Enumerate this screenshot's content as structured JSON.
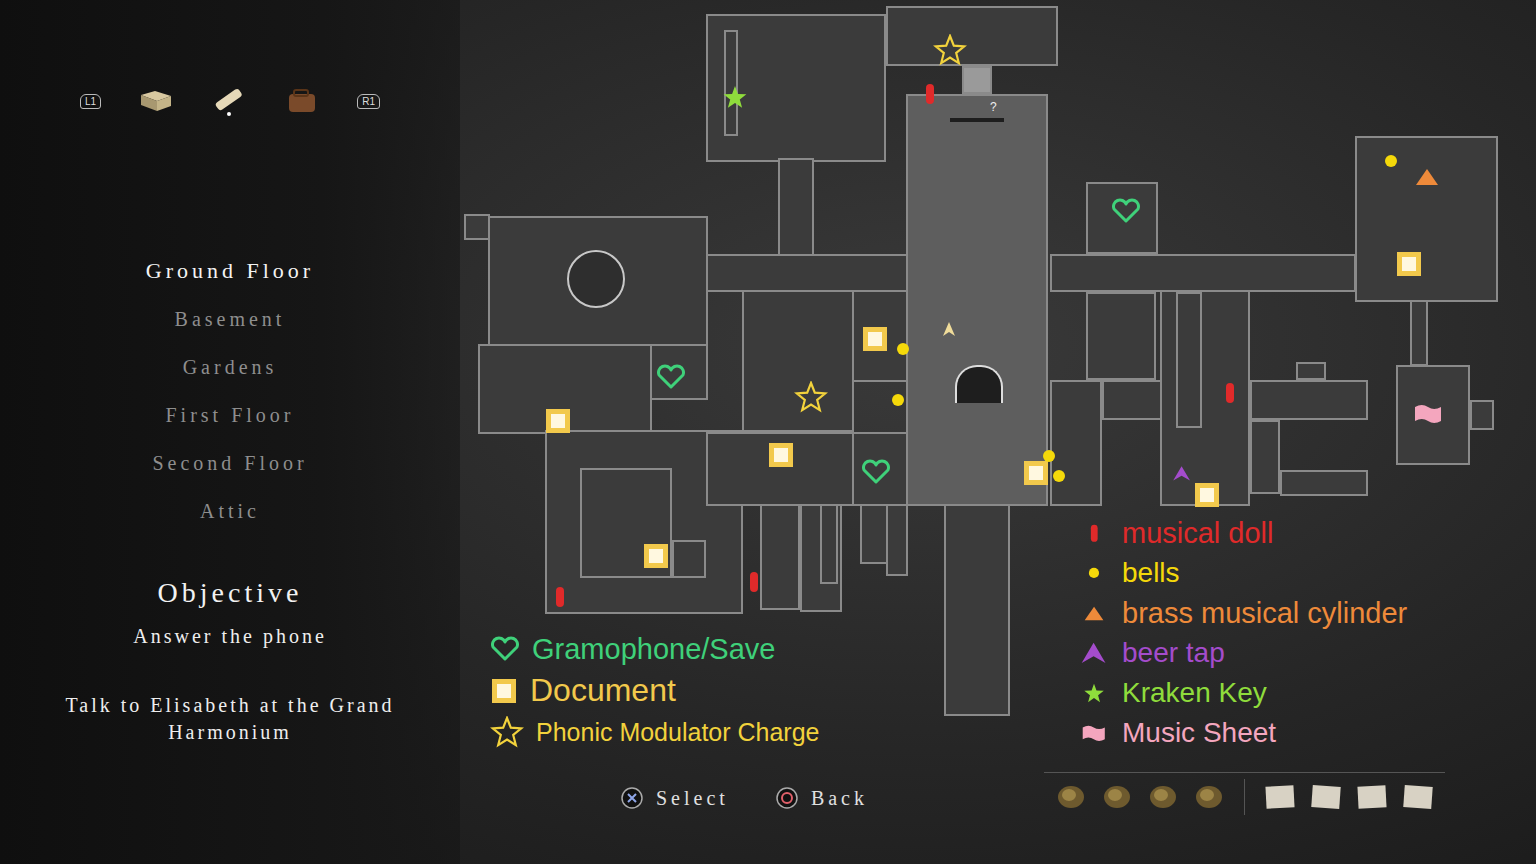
{
  "header": {
    "left_button": "L1",
    "right_button": "R1"
  },
  "floors": [
    {
      "label": "Ground Floor",
      "selected": true
    },
    {
      "label": "Basement",
      "selected": false
    },
    {
      "label": "Gardens",
      "selected": false
    },
    {
      "label": "First Floor",
      "selected": false
    },
    {
      "label": "Second Floor",
      "selected": false
    },
    {
      "label": "Attic",
      "selected": false
    }
  ],
  "objective": {
    "title": "Objective",
    "items": [
      "Answer the phone",
      "Talk to Elisabeth at the Grand Harmonium"
    ]
  },
  "map_labels": [
    "?"
  ],
  "legend_left": [
    {
      "label": "Gramophone/Save",
      "kind": "heart",
      "color": "#3fd17a"
    },
    {
      "label": "Document",
      "kind": "document",
      "color": "#f2c94c"
    },
    {
      "label": "Phonic Modulator Charge",
      "kind": "star",
      "color": "#f2d23c"
    }
  ],
  "legend_right": [
    {
      "label": "musical doll",
      "kind": "doll",
      "color": "#e02a2a"
    },
    {
      "label": "bells",
      "kind": "bell",
      "color": "#f5d90a"
    },
    {
      "label": "brass musical cylinder",
      "kind": "cylinder",
      "color": "#ee8a3a"
    },
    {
      "label": "beer tap",
      "kind": "tap",
      "color": "#a44ccc"
    },
    {
      "label": "Kraken Key",
      "kind": "kraken",
      "color": "#8fdc3c"
    },
    {
      "label": "Music Sheet",
      "kind": "sheet",
      "color": "#f4a6be"
    }
  ],
  "markers": [
    {
      "kind": "document"
    },
    {
      "kind": "document"
    },
    {
      "kind": "document"
    },
    {
      "kind": "document"
    },
    {
      "kind": "document"
    },
    {
      "kind": "document"
    },
    {
      "kind": "document"
    },
    {
      "kind": "bell"
    },
    {
      "kind": "bell"
    },
    {
      "kind": "bell"
    },
    {
      "kind": "bell"
    },
    {
      "kind": "bell"
    },
    {
      "kind": "doll"
    },
    {
      "kind": "doll"
    },
    {
      "kind": "doll"
    },
    {
      "kind": "doll"
    },
    {
      "kind": "star"
    },
    {
      "kind": "star"
    },
    {
      "kind": "kraken"
    },
    {
      "kind": "heart"
    },
    {
      "kind": "heart"
    },
    {
      "kind": "heart"
    },
    {
      "kind": "cylinder"
    },
    {
      "kind": "tap"
    },
    {
      "kind": "sheet"
    }
  ],
  "controls": [
    {
      "label": "Select",
      "kind": "cross"
    },
    {
      "label": "Back",
      "kind": "circle"
    }
  ]
}
